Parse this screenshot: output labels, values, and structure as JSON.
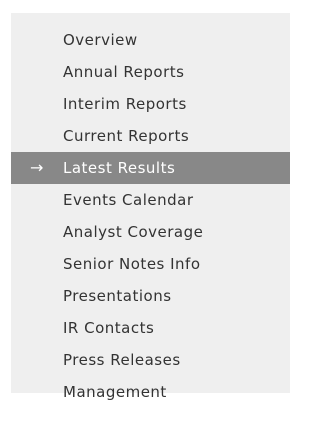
{
  "nav": {
    "active_index": 4,
    "active_marker": "→",
    "items": [
      {
        "label": "Overview"
      },
      {
        "label": "Annual Reports"
      },
      {
        "label": "Interim Reports"
      },
      {
        "label": "Current Reports"
      },
      {
        "label": "Latest Results"
      },
      {
        "label": "Events Calendar"
      },
      {
        "label": "Analyst Coverage"
      },
      {
        "label": "Senior Notes Info"
      },
      {
        "label": "Presentations"
      },
      {
        "label": "IR Contacts"
      },
      {
        "label": "Press Releases"
      },
      {
        "label": "Management"
      }
    ]
  },
  "colors": {
    "panel_bg": "#efefef",
    "active_bg": "#888888",
    "text": "#333333",
    "active_text": "#ffffff"
  }
}
